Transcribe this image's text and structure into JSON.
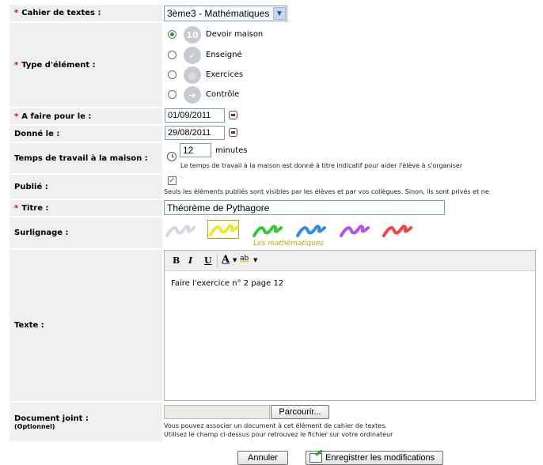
{
  "form": {
    "cahier": {
      "label": "Cahier de textes :",
      "value": "3ème3 - Mathématiques"
    },
    "type": {
      "label": "Type d'élément :",
      "options": [
        {
          "label": "Devoir maison",
          "icon": "ten-icon",
          "glyph": "10",
          "color": "#c9cbd2",
          "selected": true
        },
        {
          "label": "Enseigné",
          "icon": "check-icon",
          "glyph": "✓",
          "color": "#c9cbd2",
          "selected": false
        },
        {
          "label": "Exercices",
          "icon": "target-icon",
          "glyph": "◎",
          "color": "#c9cbd2",
          "selected": false
        },
        {
          "label": "Contrôle",
          "icon": "arrow-right-icon",
          "glyph": "➔",
          "color": "#c9cbd2",
          "selected": false
        }
      ]
    },
    "afaire": {
      "label": "A faire pour le :",
      "value": "01/09/2011"
    },
    "donne": {
      "label": "Donné le :",
      "value": "29/08/2011"
    },
    "temps": {
      "label": "Temps de travail à la maison :",
      "value": "12",
      "unit": "minutes",
      "help": "Le temps de travail à la maison est donné à titre indicatif pour aider l'élève à s'organiser"
    },
    "publie": {
      "label": "Publié :",
      "checked": true,
      "help": "Seuls les éléments publiés sont visibles par les élèves et par vos collègues. Sinon, ils sont privés et ne"
    },
    "titre": {
      "label": "Titre :",
      "value": "Théorème de Pythagore"
    },
    "surlignage": {
      "label": "Surlignage :",
      "colors": [
        "#cfd3e4",
        "#f2e21e",
        "#22c322",
        "#1f7de8",
        "#a83ff0",
        "#ef3030"
      ],
      "selected_caption": "Les mathématiques",
      "caption_color": "#c9a400"
    },
    "texte": {
      "label": "Texte :",
      "toolbar": {
        "bold": "B",
        "italic": "I",
        "underline": "U",
        "font_color": "A",
        "highlight": "ab"
      },
      "content": "Faire l'exercice n° 2 page 12"
    },
    "document": {
      "label": "Document joint :",
      "sublabel": "(Optionnel)",
      "browse_label": "Parcourir...",
      "help1": "Vous pouvez associer un document à cet élément de cahier de textes.",
      "help2": "Utilisez le champ ci-dessus pour retrouvez le fichier sur votre ordinateur"
    }
  },
  "actions": {
    "cancel_label": "Annuler",
    "save_label": "Enregistrer les modifications"
  },
  "required_marker": "*"
}
